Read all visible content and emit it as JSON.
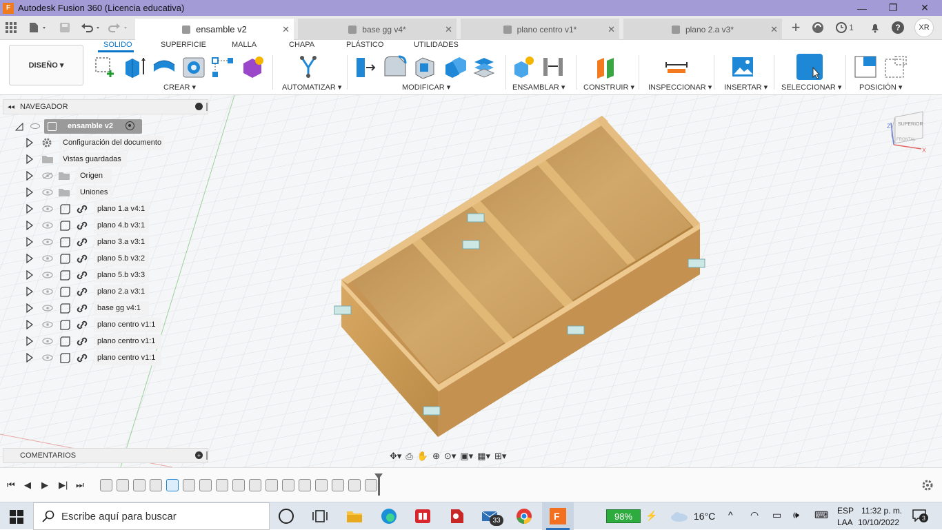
{
  "app": {
    "title": "Autodesk Fusion 360 (Licencia educativa)",
    "logo": "F"
  },
  "window_controls": {
    "minimize": "—",
    "maximize": "❐",
    "close": "✕"
  },
  "tabs": [
    {
      "label": "ensamble v2",
      "active": true
    },
    {
      "label": "base gg v4*",
      "active": false
    },
    {
      "label": "plano centro v1*",
      "active": false
    },
    {
      "label": "plano 2.a v3*",
      "active": false
    }
  ],
  "tabbar": {
    "jobs_count": "1",
    "user_initials": "XR",
    "help": "?"
  },
  "workspace": {
    "label": "DISEÑO ▾"
  },
  "ribbon_tabs": [
    "SOLIDO",
    "SUPERFICIE",
    "MALLA",
    "CHAPA",
    "PLÁSTICO",
    "UTILIDADES"
  ],
  "ribbon_groups": [
    "CREAR ▾",
    "AUTOMATIZAR ▾",
    "MODIFICAR ▾",
    "ENSAMBLAR ▾",
    "CONSTRUIR ▾",
    "INSPECCIONAR ▾",
    "INSERTAR ▾",
    "SELECCIONAR ▾",
    "POSICIÓN ▾"
  ],
  "navigator": {
    "title": "NAVEGADOR",
    "root": "ensamble v2",
    "items": [
      {
        "label": "Configuración del documento",
        "icon": "gear-icon"
      },
      {
        "label": "Vistas guardadas",
        "icon": "folder-icon"
      },
      {
        "label": "Origen",
        "icon": "folder-icon"
      },
      {
        "label": "Uniones",
        "icon": "folder-icon"
      },
      {
        "label": "plano 1.a v4:1",
        "icon": "component-icon"
      },
      {
        "label": "plano 4.b v3:1",
        "icon": "component-icon"
      },
      {
        "label": "plano 3.a v3:1",
        "icon": "component-icon"
      },
      {
        "label": "plano 5.b v3:2",
        "icon": "component-icon"
      },
      {
        "label": "plano 5.b v3:3",
        "icon": "component-icon"
      },
      {
        "label": "plano 2.a v3:1",
        "icon": "component-icon"
      },
      {
        "label": "base gg v4:1",
        "icon": "component-icon"
      },
      {
        "label": "plano centro v1:1",
        "icon": "component-icon"
      },
      {
        "label": "plano centro v1:1",
        "icon": "component-icon"
      },
      {
        "label": "plano centro v1:1",
        "icon": "component-icon"
      }
    ]
  },
  "viewcube": {
    "top": "SUPERIOR",
    "front": "FRONTAL",
    "axis_x": "X",
    "axis_z": "Z"
  },
  "comments": {
    "title": "COMENTARIOS"
  },
  "taskbar": {
    "search_placeholder": "Escribe aquí para buscar",
    "mail_badge": "33",
    "battery": "98%",
    "temperature": "16°C",
    "lang_top": "ESP",
    "lang_bottom": "LAA",
    "time": "11:32 p. m.",
    "date": "10/10/2022",
    "notifications": "3"
  }
}
